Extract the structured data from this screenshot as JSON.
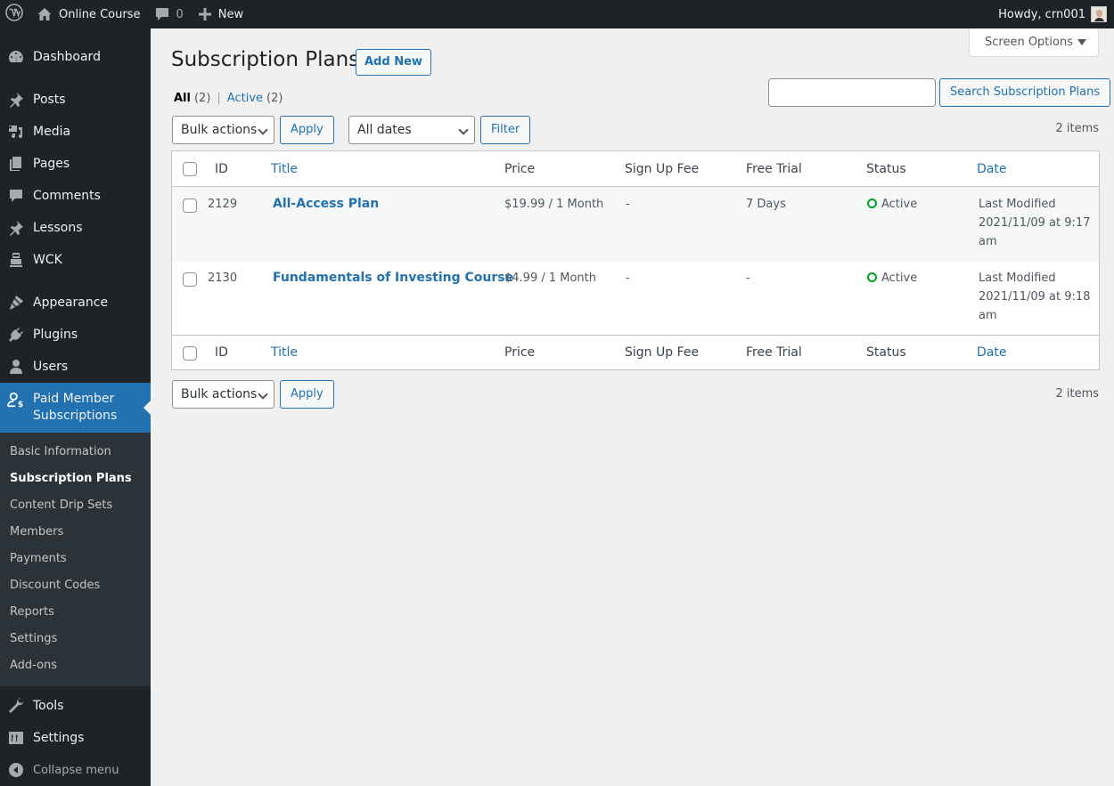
{
  "adminbar": {
    "site_name": "Online Course",
    "comments_count": "0",
    "new_label": "New",
    "greeting": "Howdy, crn001"
  },
  "sidebar": {
    "items": [
      {
        "label": "Dashboard",
        "icon": "dashboard-icon"
      },
      {
        "label": "Posts",
        "icon": "pin-icon"
      },
      {
        "label": "Media",
        "icon": "media-icon"
      },
      {
        "label": "Pages",
        "icon": "pages-icon"
      },
      {
        "label": "Comments",
        "icon": "comment-icon"
      },
      {
        "label": "Lessons",
        "icon": "pin-icon"
      },
      {
        "label": "WCK",
        "icon": "robot-icon"
      },
      {
        "label": "Appearance",
        "icon": "paintbrush-icon"
      },
      {
        "label": "Plugins",
        "icon": "plugin-icon"
      },
      {
        "label": "Users",
        "icon": "user-icon"
      },
      {
        "label": "Paid Member Subscriptions",
        "label_line1": "Paid Member",
        "label_line2": "Subscriptions",
        "icon": "member-dollar-icon",
        "current": true
      },
      {
        "label": "Tools",
        "icon": "wrench-icon"
      },
      {
        "label": "Settings",
        "icon": "settings-icon"
      }
    ],
    "submenu": [
      {
        "label": "Basic Information"
      },
      {
        "label": "Subscription Plans",
        "active": true
      },
      {
        "label": "Content Drip Sets"
      },
      {
        "label": "Members"
      },
      {
        "label": "Payments"
      },
      {
        "label": "Discount Codes"
      },
      {
        "label": "Reports"
      },
      {
        "label": "Settings"
      },
      {
        "label": "Add-ons"
      }
    ],
    "collapse_label": "Collapse menu"
  },
  "main": {
    "screen_options": "Screen Options",
    "title": "Subscription Plans",
    "add_new": "Add New",
    "views": {
      "all_label": "All",
      "all_count": "(2)",
      "separator": "|",
      "active_label": "Active",
      "active_count": "(2)"
    },
    "search": {
      "value": "",
      "placeholder": "",
      "button": "Search Subscription Plans"
    },
    "top_nav": {
      "bulk_actions": "Bulk actions",
      "apply": "Apply",
      "dates_filter": "All dates",
      "filter": "Filter",
      "items_count": "2 items"
    },
    "bottom_nav": {
      "bulk_actions": "Bulk actions",
      "apply": "Apply",
      "items_count": "2 items"
    },
    "table": {
      "columns": [
        "ID",
        "Title",
        "Price",
        "Sign Up Fee",
        "Free Trial",
        "Status",
        "Date"
      ],
      "sortable": [
        "Title",
        "Date"
      ],
      "rows": [
        {
          "id": "2129",
          "title": "All-Access Plan",
          "price": "$19.99 / 1 Month",
          "signup_fee": "-",
          "free_trial": "7 Days",
          "status": "Active",
          "date_label": "Last Modified",
          "date_value": "2021/11/09 at 9:17",
          "date_suffix": "am"
        },
        {
          "id": "2130",
          "title": "Fundamentals of Investing Course",
          "price": "$4.99 / 1 Month",
          "signup_fee": "-",
          "free_trial": "-",
          "status": "Active",
          "date_label": "Last Modified",
          "date_value": "2021/11/09 at 9:18",
          "date_suffix": "am"
        }
      ]
    },
    "colors": {
      "accent": "#2271b1",
      "status_active": "#00a32a",
      "sidebar_bg": "#1d2327"
    }
  }
}
